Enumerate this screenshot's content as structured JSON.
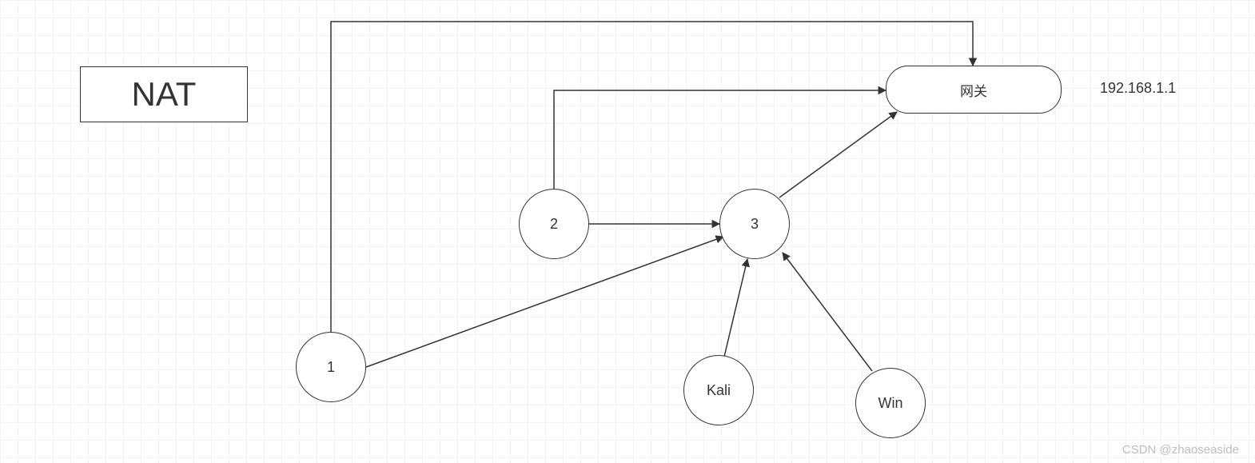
{
  "nat_box": {
    "label": "NAT"
  },
  "gateway": {
    "label": "网关",
    "ip": "192.168.1.1"
  },
  "nodes": {
    "n1": "1",
    "n2": "2",
    "n3": "3",
    "kali": "Kali",
    "win": "Win"
  },
  "watermark": "CSDN @zhaoseaside"
}
